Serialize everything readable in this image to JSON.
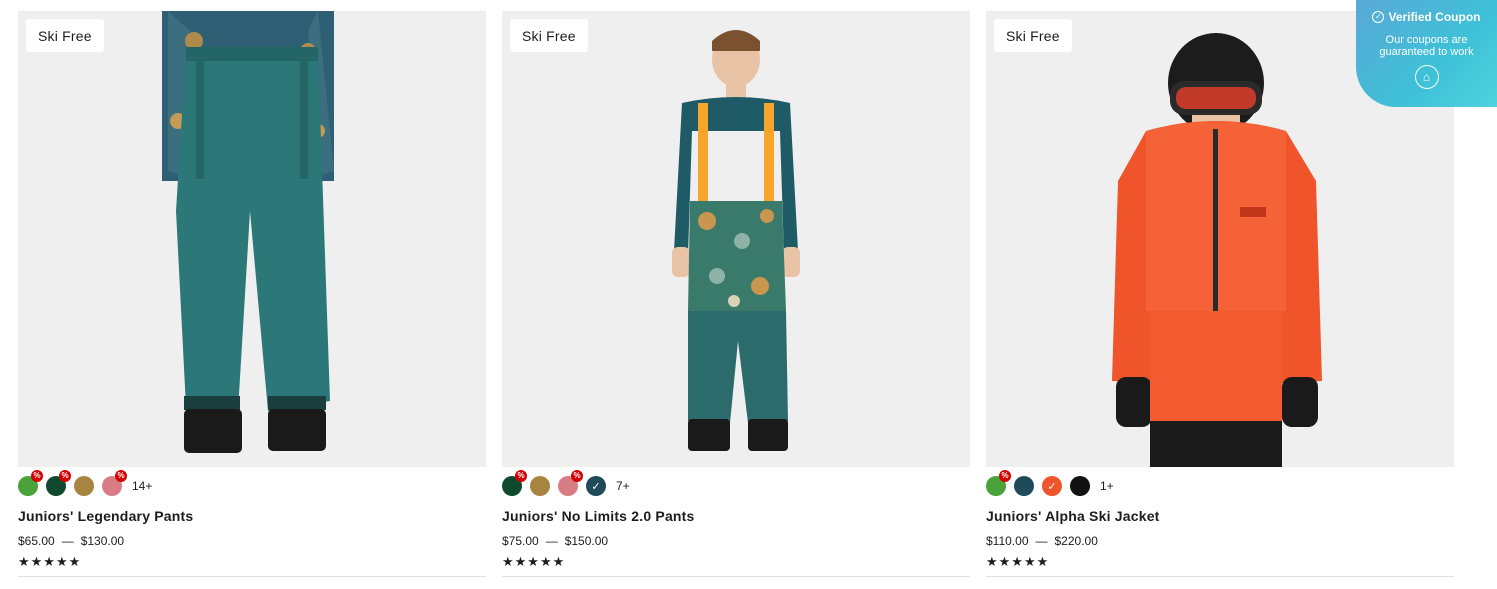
{
  "products": [
    {
      "badge": "Ski Free",
      "name": "Juniors' Legendary Pants",
      "price_low": "$65.00",
      "price_sep": "—",
      "price_high": "$130.00",
      "rating": "★★★★★",
      "more_colors": "14+",
      "swatches": [
        {
          "color": "#4aa23a",
          "sale": "%"
        },
        {
          "color": "#0f4a2e",
          "sale": "%"
        },
        {
          "color": "#a78541",
          "sale": ""
        },
        {
          "color": "#d87c86",
          "sale": "%"
        }
      ]
    },
    {
      "badge": "Ski Free",
      "name": "Juniors' No Limits 2.0 Pants",
      "price_low": "$75.00",
      "price_sep": "—",
      "price_high": "$150.00",
      "rating": "★★★★★",
      "more_colors": "7+",
      "swatches": [
        {
          "color": "#0f4a2e",
          "sale": "%"
        },
        {
          "color": "#a78541",
          "sale": ""
        },
        {
          "color": "#d87c86",
          "sale": "%"
        },
        {
          "color": "#1f4a5a",
          "sale": "",
          "check": "✓"
        }
      ]
    },
    {
      "badge": "Ski Free",
      "name": "Juniors' Alpha Ski Jacket",
      "price_low": "$110.00",
      "price_sep": "—",
      "price_high": "$220.00",
      "rating": "★★★★★",
      "more_colors": "1+",
      "swatches": [
        {
          "color": "#4aa23a",
          "sale": "%"
        },
        {
          "color": "#1f4a5a",
          "sale": ""
        },
        {
          "color": "#f0542a",
          "sale": "",
          "check": "✓"
        },
        {
          "color": "#111111",
          "sale": ""
        }
      ]
    }
  ],
  "coupon": {
    "title": "Verified Coupon",
    "ok_icon": "✓",
    "subtitle": "Our coupons are guaranteed to work",
    "logo_icon": "⌂"
  }
}
